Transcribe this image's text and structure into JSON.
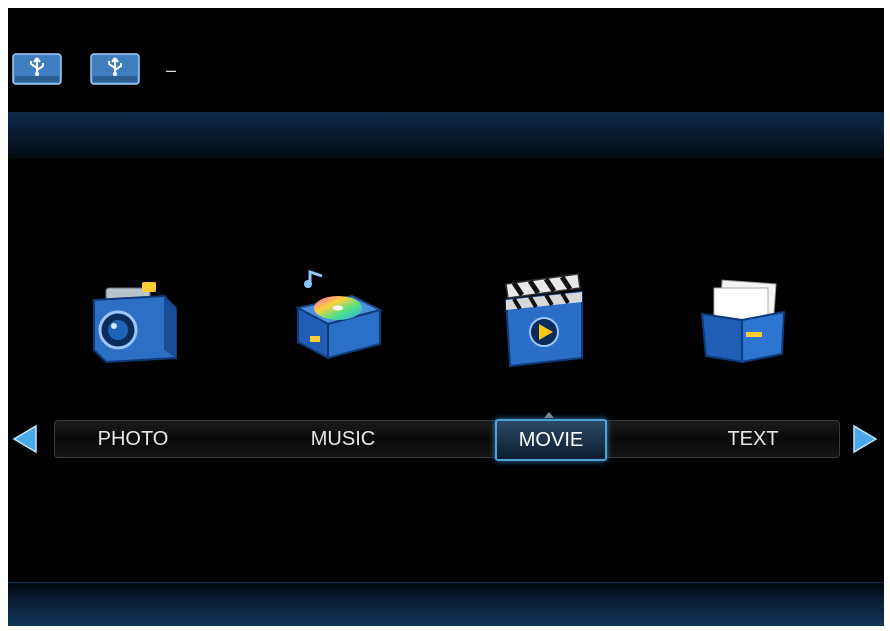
{
  "status_bar": {
    "devices": [
      {
        "icon": "usb-drive-icon"
      },
      {
        "icon": "usb-drive-icon"
      }
    ],
    "device_placeholder": "–"
  },
  "menu": {
    "items": [
      {
        "label": "PHOTO",
        "icon": "camera-icon"
      },
      {
        "label": "MUSIC",
        "icon": "music-player-icon"
      },
      {
        "label": "MOVIE",
        "icon": "clapperboard-icon"
      },
      {
        "label": "TEXT",
        "icon": "document-folder-icon"
      }
    ],
    "selected": "MOVIE",
    "nav": {
      "left": "left-arrow-icon",
      "right": "right-arrow-icon"
    }
  },
  "colors": {
    "accent": "#4fa3d6",
    "background": "#000000",
    "band": "#0c2a48"
  }
}
